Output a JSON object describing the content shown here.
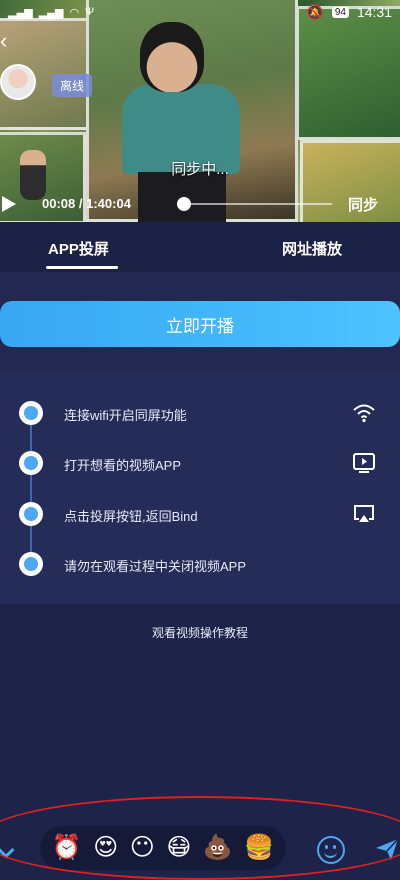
{
  "status_bar": {
    "left_icons": [
      "signal-icon",
      "signal-icon",
      "wifi-icon",
      "usb-icon"
    ],
    "battery": "94",
    "time": "14:31"
  },
  "video": {
    "offline_badge": "离线",
    "sync_status": "同步中...",
    "current_time": "00:08",
    "separator": "/",
    "duration": "1:40:04",
    "progress_fraction": 0.08,
    "sync_button": "同步"
  },
  "tabs": [
    {
      "label": "APP投屏",
      "active": true
    },
    {
      "label": "网址播放",
      "active": false
    }
  ],
  "start_button": "立即开播",
  "steps": [
    {
      "text": "连接wifi开启同屏功能",
      "icon": "wifi-icon"
    },
    {
      "text": "打开想看的视频APP",
      "icon": "video-app-icon"
    },
    {
      "text": "点击投屏按钮,返回Bind",
      "icon": "screencast-icon"
    },
    {
      "text": "请勿在观看过程中关闭视频APP",
      "icon": ""
    }
  ],
  "tutorial_link": "观看视频操作教程",
  "emoji_bar": {
    "emojis": [
      "⏰",
      "😍",
      "😶",
      "😷",
      "💩",
      "🍔"
    ]
  },
  "colors": {
    "background": "#1e2349",
    "accent": "#4da7f2",
    "highlight": "#e0201e"
  }
}
